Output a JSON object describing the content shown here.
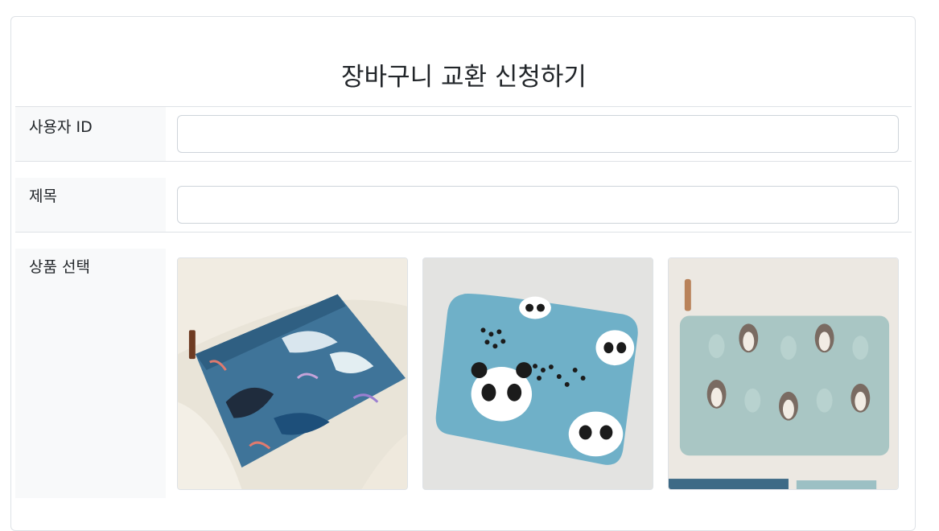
{
  "form": {
    "title": "장바구니 교환 신청하기",
    "user_id_label": "사용자 ID",
    "user_id_value": "",
    "subject_label": "제목",
    "subject_value": "",
    "product_label": "상품 선택"
  },
  "products": [
    {
      "icon": "whale-pattern-bag-image"
    },
    {
      "icon": "panda-pattern-bag-image"
    },
    {
      "icon": "penguin-pattern-bag-image"
    }
  ]
}
